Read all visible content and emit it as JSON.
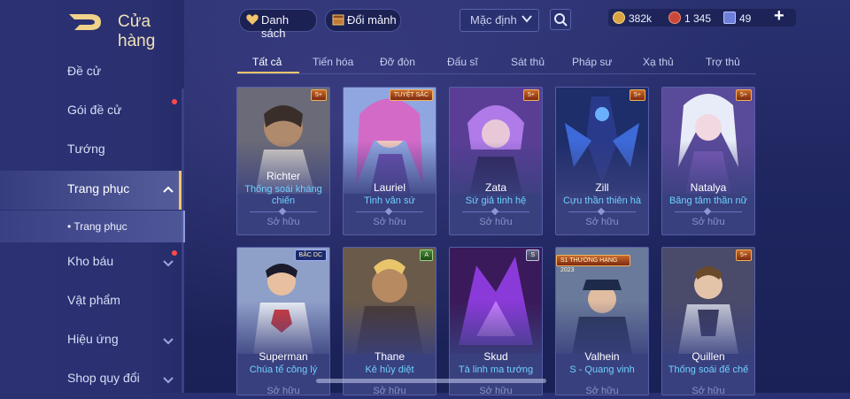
{
  "sidebar": {
    "title": "Cửa hàng",
    "items": [
      {
        "label": "Đề cử"
      },
      {
        "label": "Gói đề cử"
      },
      {
        "label": "Tướng"
      },
      {
        "label": "Trang phục"
      },
      {
        "label": "Kho báu"
      },
      {
        "label": "Vật phẩm"
      },
      {
        "label": "Hiệu ứng"
      },
      {
        "label": "Shop quy đổi"
      }
    ],
    "sub_item": "• Trang phục"
  },
  "topbar": {
    "collection_label": "Danh sách",
    "exchange_label": "Đổi mảnh",
    "sort_value": "Mặc định",
    "currency": {
      "gold": "382k",
      "gems": "1 345",
      "vouchers": "49"
    }
  },
  "tabs": [
    "Tất cả",
    "Tiến hóa",
    "Đỡ đòn",
    "Đấu sĩ",
    "Sát thủ",
    "Pháp sư",
    "Xạ thủ",
    "Trợ thủ"
  ],
  "cards": [
    {
      "hero": "Richter",
      "skin": "Thống soái kháng chiến",
      "status": "Sở hữu",
      "badge": "5+"
    },
    {
      "hero": "Lauriel",
      "skin": "Tinh vân sứ",
      "status": "Sở hữu",
      "badge": "TUYỆT SẮC"
    },
    {
      "hero": "Zata",
      "skin": "Sứ giả tinh hệ",
      "status": "Sở hữu",
      "badge": "5+"
    },
    {
      "hero": "Zill",
      "skin": "Cựu thần thiên hà",
      "status": "Sở hữu",
      "badge": "5+"
    },
    {
      "hero": "Natalya",
      "skin": "Băng tâm thần nữ",
      "status": "Sở hữu",
      "badge": "5+"
    },
    {
      "hero": "Superman",
      "skin": "Chúa tể công lý",
      "status": "Sở hữu",
      "badge": "BẬC DC"
    },
    {
      "hero": "Thane",
      "skin": "Kẻ hủy diệt",
      "status": "Sở hữu",
      "badge": "A"
    },
    {
      "hero": "Skud",
      "skin": "Tà linh ma tướng",
      "status": "Sở hữu",
      "badge": "S"
    },
    {
      "hero": "Valhein",
      "skin": "S - Quang vinh",
      "status": "Sở hữu",
      "badge": "S1 THƯỜNG HẠNG 2023"
    },
    {
      "hero": "Quillen",
      "skin": "Thống soái đế chế",
      "status": "Sở hữu",
      "badge": "5+"
    }
  ],
  "colors": {
    "accent": "#f2c56b",
    "skin_text": "#6fd0ff",
    "background": "#1f2660"
  }
}
